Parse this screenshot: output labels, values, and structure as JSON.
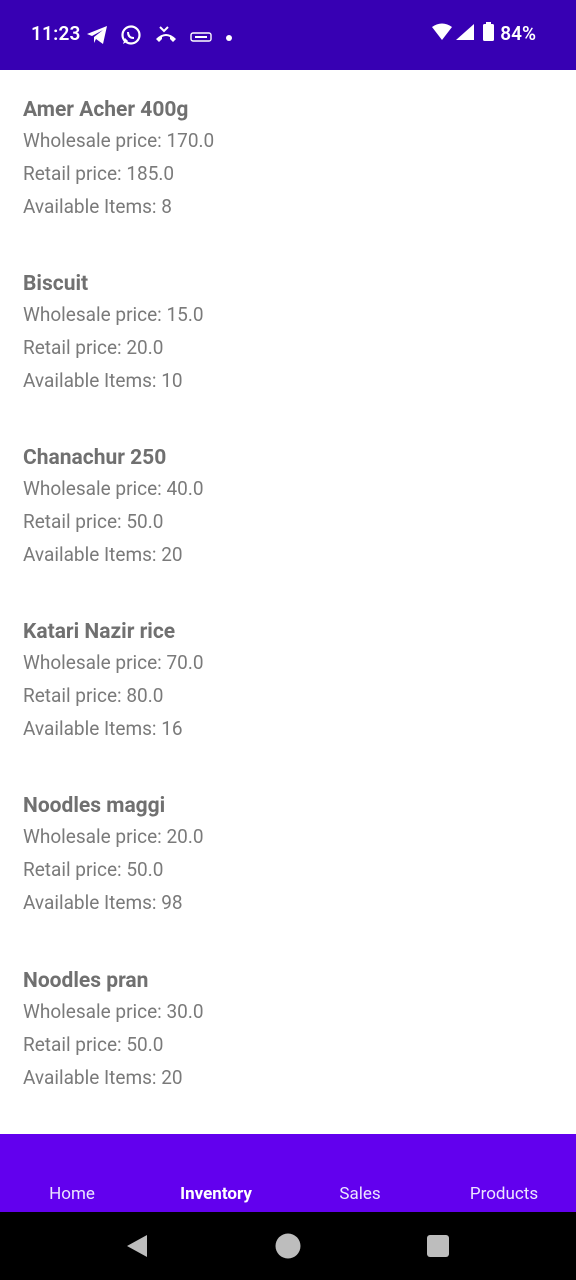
{
  "status_bar": {
    "time": "11:23",
    "battery": "84%",
    "icons": [
      "telegram-icon",
      "whatsapp-icon",
      "missed-call-icon",
      "carrier-icon",
      "dot-icon",
      "wifi-icon",
      "signal-icon",
      "battery-icon"
    ]
  },
  "products": [
    {
      "name": "Amer Acher 400g",
      "wholesale": "Wholesale price: 170.0",
      "retail": "Retail price: 185.0",
      "available": "Available Items: 8"
    },
    {
      "name": "Biscuit",
      "wholesale": "Wholesale price: 15.0",
      "retail": "Retail price: 20.0",
      "available": "Available Items: 10"
    },
    {
      "name": "Chanachur 250",
      "wholesale": "Wholesale price: 40.0",
      "retail": "Retail price: 50.0",
      "available": "Available Items: 20"
    },
    {
      "name": "Katari Nazir rice",
      "wholesale": "Wholesale price: 70.0",
      "retail": "Retail price: 80.0",
      "available": "Available Items: 16"
    },
    {
      "name": "Noodles maggi",
      "wholesale": "Wholesale price: 20.0",
      "retail": "Retail price: 50.0",
      "available": "Available Items: 98"
    },
    {
      "name": "Noodles pran",
      "wholesale": "Wholesale price: 30.0",
      "retail": "Retail price: 50.0",
      "available": "Available Items: 20"
    }
  ],
  "bottom_nav": {
    "items": [
      {
        "label": "Home"
      },
      {
        "label": "Inventory",
        "active": true
      },
      {
        "label": "Sales"
      },
      {
        "label": "Products"
      }
    ]
  },
  "colors": {
    "status_bar": "#3700b3",
    "bottom_nav": "#6200ee"
  }
}
